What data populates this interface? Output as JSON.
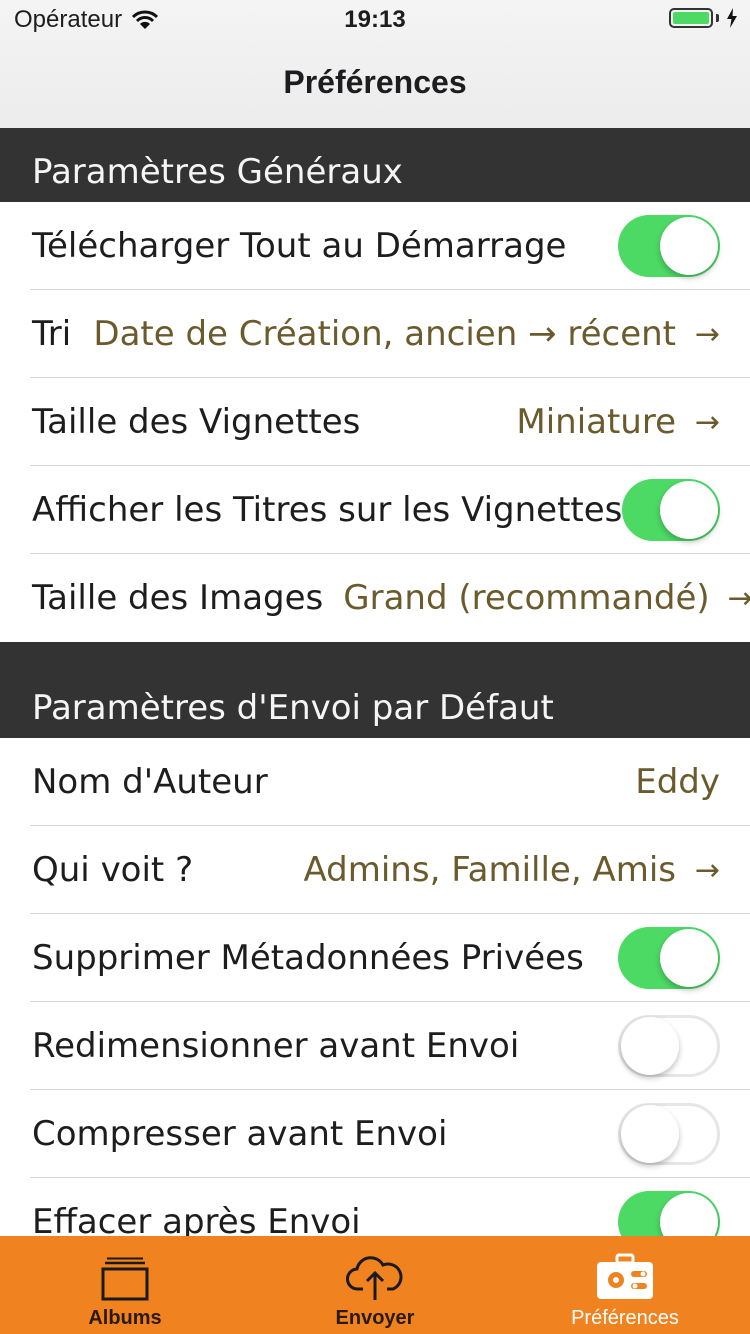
{
  "status": {
    "carrier": "Opérateur",
    "time": "19:13"
  },
  "nav": {
    "title": "Préférences"
  },
  "sections": [
    {
      "header": "Paramètres Généraux",
      "rows": [
        {
          "label": "Télécharger Tout au Démarrage",
          "toggle": true
        },
        {
          "label": "Tri",
          "value": "Date de Création, ancien → récent",
          "chevron": "→"
        },
        {
          "label": "Taille des Vignettes",
          "value": "Miniature",
          "chevron": "→"
        },
        {
          "label": "Afficher les Titres sur les Vignettes",
          "toggle": true
        },
        {
          "label": "Taille des Images",
          "value": "Grand (recommandé)",
          "chevron": "→"
        }
      ]
    },
    {
      "header": "Paramètres d'Envoi par Défaut",
      "rows": [
        {
          "label": "Nom d'Auteur",
          "value": "Eddy"
        },
        {
          "label": "Qui voit ?",
          "value": "Admins, Famille, Amis",
          "chevron": "→"
        },
        {
          "label": "Supprimer Métadonnées Privées",
          "toggle": true
        },
        {
          "label": "Redimensionner avant Envoi",
          "toggle": false
        },
        {
          "label": "Compresser avant Envoi",
          "toggle": false
        },
        {
          "label": "Effacer après Envoi",
          "toggle": true
        }
      ]
    }
  ],
  "tabs": [
    {
      "label": "Albums",
      "icon": "albums-icon",
      "active": false
    },
    {
      "label": "Envoyer",
      "icon": "cloud-upload-icon",
      "active": false
    },
    {
      "label": "Préférences",
      "icon": "settings-toolbox-icon",
      "active": true
    }
  ],
  "colors": {
    "accent": "#f08320",
    "value_text": "#6b5a2c",
    "switch_on": "#4cd964",
    "section_bg": "#333333"
  }
}
